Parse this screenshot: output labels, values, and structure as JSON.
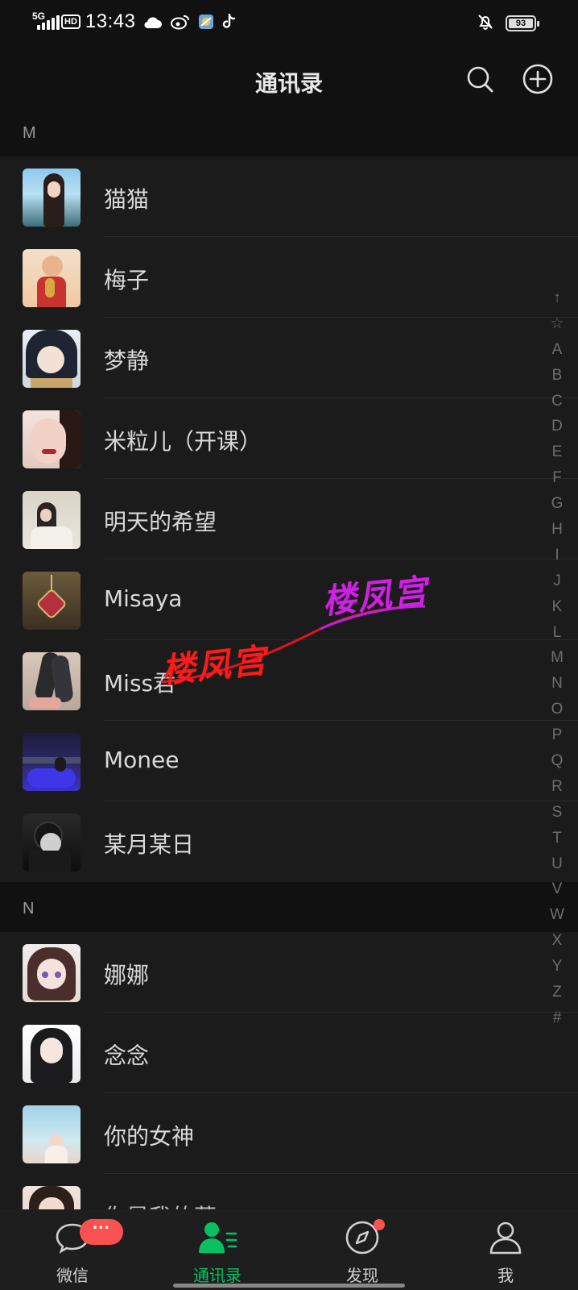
{
  "status_bar": {
    "network": "5G",
    "hd": "HD",
    "time": "13:43",
    "battery": "93"
  },
  "header": {
    "title": "通讯录",
    "icons": [
      "search-icon",
      "add-icon"
    ]
  },
  "sections": [
    {
      "letter": "M",
      "contacts": [
        "猫猫",
        "梅子",
        "梦静",
        "米粒儿（开课）",
        "明天的希望",
        "Misaya",
        "Miss君",
        "Monee",
        "某月某日"
      ]
    },
    {
      "letter": "N",
      "contacts": [
        "娜娜",
        "念念",
        "你的女神"
      ]
    }
  ],
  "index_bar": [
    "↑",
    "☆",
    "A",
    "B",
    "C",
    "D",
    "E",
    "F",
    "G",
    "H",
    "I",
    "J",
    "K",
    "L",
    "M",
    "N",
    "O",
    "P",
    "Q",
    "R",
    "S",
    "T",
    "U",
    "V",
    "W",
    "X",
    "Y",
    "Z",
    "#"
  ],
  "watermark": {
    "text1": "楼凤宫",
    "text2": "楼凤宫"
  },
  "bottom_nav": {
    "tabs": [
      {
        "label": "微信",
        "icon": "chat-bubble-icon",
        "badge": "···"
      },
      {
        "label": "通讯录",
        "icon": "contacts-icon",
        "active": true
      },
      {
        "label": "发现",
        "icon": "compass-icon"
      },
      {
        "label": "我",
        "icon": "person-icon"
      }
    ]
  },
  "colors": {
    "accent": "#07c160",
    "badge": "#fa5151",
    "background": "#111111",
    "list_bg": "#1b1b1b"
  }
}
